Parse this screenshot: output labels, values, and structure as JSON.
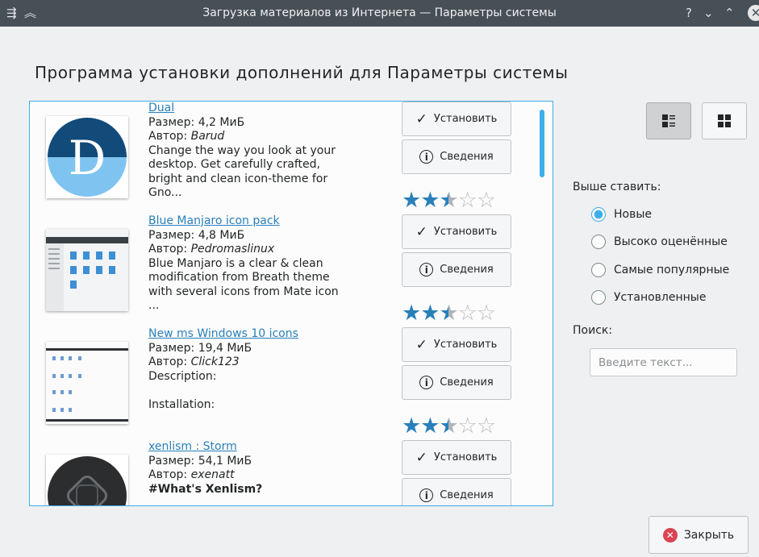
{
  "window": {
    "title": "Загрузка материалов из Интернета — Параметры системы",
    "left_icons": [
      "menu-icon",
      "keep-above-icon"
    ],
    "right_icons": [
      "help-icon",
      "minimize-icon",
      "maximize-icon",
      "close-icon"
    ]
  },
  "heading": "Программа установки дополнений для Параметры системы",
  "items": [
    {
      "name": "Dual",
      "size": "Размер: 4,2 МиБ",
      "author_label": "Автор:",
      "author": "Barud",
      "description": "Change the way you look at your\ndesktop. Get carefully crafted,\nbright and clean icon-theme for\nGno...",
      "rating": 2.5,
      "install_label": "Установить",
      "details_label": "Сведения",
      "thumb_letter": "D"
    },
    {
      "name": "Blue Manjaro icon pack",
      "size": "Размер: 4,8 МиБ",
      "author_label": "Автор:",
      "author": "Pedromaslinux",
      "description": "Blue Manjaro is a clear & clean\nmodification from Breath theme\nwith several icons from Mate icon\n...",
      "rating": 2.5,
      "install_label": "Установить",
      "details_label": "Сведения"
    },
    {
      "name": "New ms Windows 10 icons",
      "size": "Размер: 19,4 МиБ",
      "author_label": "Автор:",
      "author": "Click123",
      "description": "Description:\n\n Installation:",
      "rating": 2.5,
      "install_label": "Установить",
      "details_label": "Сведения"
    },
    {
      "name": "xenlism : Storm",
      "size": "Размер: 54,1 МиБ",
      "author_label": "Автор:",
      "author": "exenatt",
      "description": "#What's Xenlism?",
      "rating": 2.5,
      "install_label": "Установить",
      "details_label": "Сведения"
    }
  ],
  "view_modes": [
    {
      "name": "list-view-icon",
      "active": true
    },
    {
      "name": "grid-view-icon",
      "active": false
    }
  ],
  "sort": {
    "label": "Выше ставить:",
    "options": [
      {
        "label": "Новые",
        "selected": true
      },
      {
        "label": "Высоко оценённые",
        "selected": false
      },
      {
        "label": "Самые популярные",
        "selected": false
      },
      {
        "label": "Установленные",
        "selected": false
      }
    ]
  },
  "search": {
    "label": "Поиск:",
    "placeholder": "Введите текст...",
    "value": ""
  },
  "close_button": "Закрыть",
  "colors": {
    "accent": "#3daee9",
    "link": "#2980b9",
    "titlebar": "#475057",
    "close_icon": "#da4453"
  }
}
